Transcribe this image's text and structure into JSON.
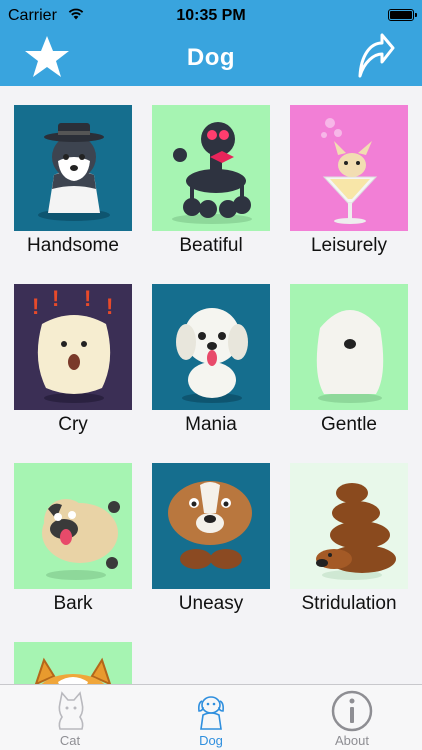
{
  "status_bar": {
    "carrier": "Carrier",
    "time": "10:35 PM"
  },
  "nav": {
    "title": "Dog",
    "left_icon": "star-icon",
    "right_icon": "share-arrow-icon"
  },
  "grid": [
    {
      "label": "Handsome",
      "bg": "#156e8e"
    },
    {
      "label": "Beatiful",
      "bg": "#a6f4b2"
    },
    {
      "label": "Leisurely",
      "bg": "#f27fd6"
    },
    {
      "label": "Cry",
      "bg": "#3b2f55"
    },
    {
      "label": "Mania",
      "bg": "#156e8e"
    },
    {
      "label": "Gentle",
      "bg": "#a6f4b2"
    },
    {
      "label": "Bark",
      "bg": "#a6f4b2"
    },
    {
      "label": "Uneasy",
      "bg": "#156e8e"
    },
    {
      "label": "Stridulation",
      "bg": "#e8f8ea"
    },
    {
      "label": "",
      "bg": "#a6f4b2"
    }
  ],
  "tabs": [
    {
      "label": "Cat",
      "icon": "cat-icon",
      "active": false
    },
    {
      "label": "Dog",
      "icon": "dog-icon",
      "active": true
    },
    {
      "label": "About",
      "icon": "info-icon",
      "active": false
    }
  ],
  "colors": {
    "bar": "#39a4de",
    "tab_active": "#2f8fde",
    "tab_inactive": "#8e8e93"
  }
}
